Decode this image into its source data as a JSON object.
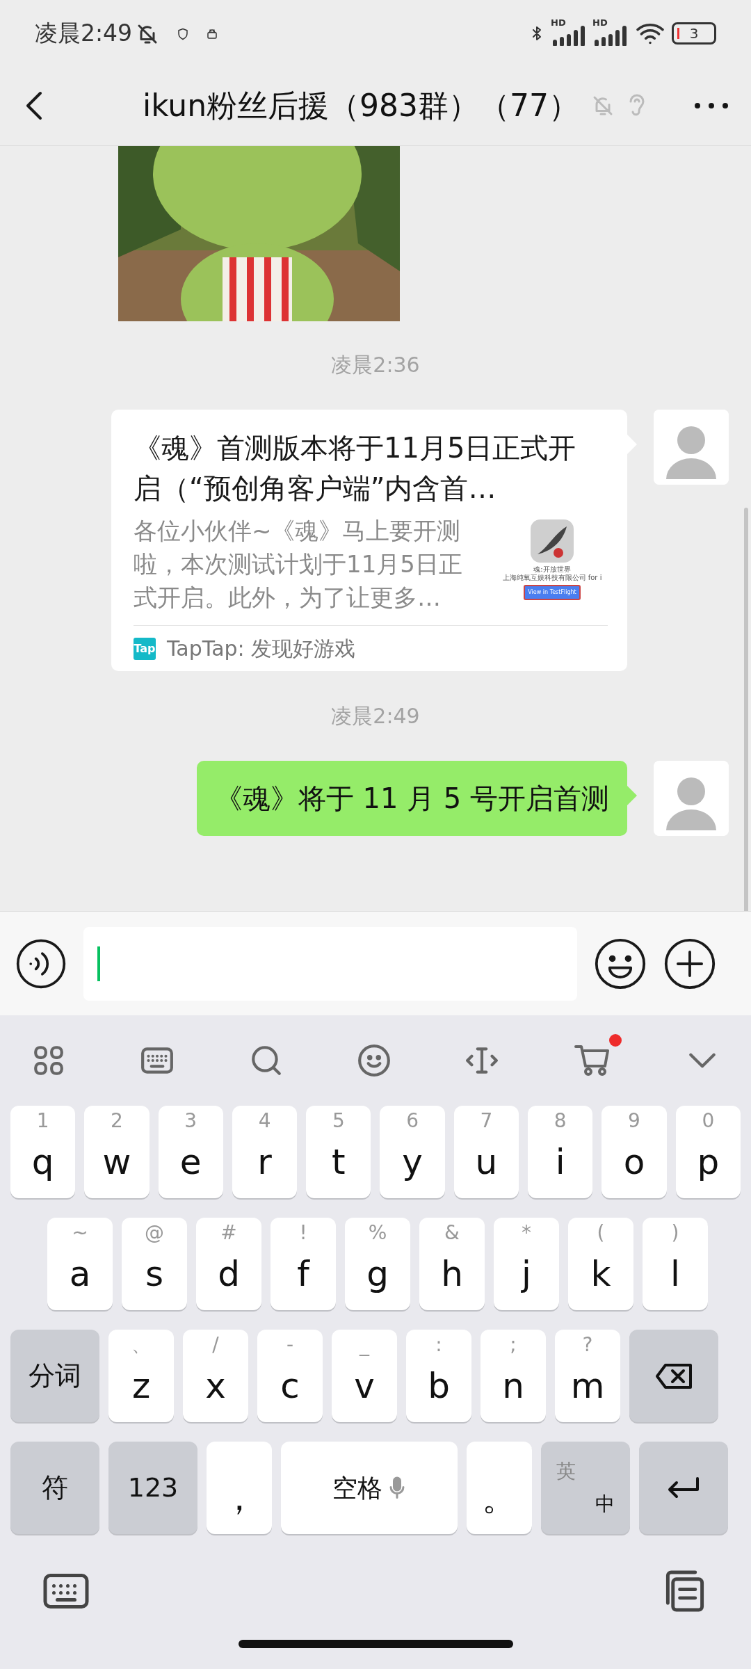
{
  "status_bar": {
    "time": "凌晨2:49",
    "signals": [
      {
        "label": "HD"
      },
      {
        "label": "HD"
      }
    ],
    "battery": "3"
  },
  "header": {
    "title": "ikun粉丝后援（983群）（77）"
  },
  "messages": [
    {
      "kind": "picture",
      "outgoing": false
    },
    {
      "kind": "time",
      "text": "凌晨2:36"
    },
    {
      "kind": "link_card",
      "outgoing": true,
      "title": "《魂》首测版本将于11月5日正式开启（“预创角客户端”内含首…",
      "description": "各位小伙伴~《魂》马上要开测啦，本次测试计划于11月5日正式开启。此外，为了让更多…",
      "thumbnail": {
        "app_name": "魂:开放世界",
        "developer": "上海纯氧互娱科技有限公司 for i",
        "button": "View in TestFlight"
      },
      "source_logo": "Tap",
      "source": "TapTap: 发现好游戏"
    },
    {
      "kind": "time",
      "text": "凌晨2:49"
    },
    {
      "kind": "text",
      "outgoing": true,
      "text": "《魂》将于 11 月 5 号开启首测"
    }
  ],
  "keyboard": {
    "rows": [
      {
        "keys": [
          {
            "kind": "char",
            "label": "q",
            "hint": "1"
          },
          {
            "kind": "char",
            "label": "w",
            "hint": "2"
          },
          {
            "kind": "char",
            "label": "e",
            "hint": "3"
          },
          {
            "kind": "char",
            "label": "r",
            "hint": "4"
          },
          {
            "kind": "char",
            "label": "t",
            "hint": "5"
          },
          {
            "kind": "char",
            "label": "y",
            "hint": "6"
          },
          {
            "kind": "char",
            "label": "u",
            "hint": "7"
          },
          {
            "kind": "char",
            "label": "i",
            "hint": "8"
          },
          {
            "kind": "char",
            "label": "o",
            "hint": "9"
          },
          {
            "kind": "char",
            "label": "p",
            "hint": "0"
          }
        ]
      },
      {
        "keys": [
          {
            "kind": "char",
            "label": "a",
            "hint": "~"
          },
          {
            "kind": "char",
            "label": "s",
            "hint": "@"
          },
          {
            "kind": "char",
            "label": "d",
            "hint": "#"
          },
          {
            "kind": "char",
            "label": "f",
            "hint": "!"
          },
          {
            "kind": "char",
            "label": "g",
            "hint": "%"
          },
          {
            "kind": "char",
            "label": "h",
            "hint": "&"
          },
          {
            "kind": "char",
            "label": "j",
            "hint": "*"
          },
          {
            "kind": "char",
            "label": "k",
            "hint": "("
          },
          {
            "kind": "char",
            "label": "l",
            "hint": ")"
          }
        ]
      },
      {
        "keys": [
          {
            "kind": "func",
            "label": "分词"
          },
          {
            "kind": "char",
            "label": "z",
            "hint": "、"
          },
          {
            "kind": "char",
            "label": "x",
            "hint": "/"
          },
          {
            "kind": "char",
            "label": "c",
            "hint": "-"
          },
          {
            "kind": "char",
            "label": "v",
            "hint": "_"
          },
          {
            "kind": "char",
            "label": "b",
            "hint": ":"
          },
          {
            "kind": "char",
            "label": "n",
            "hint": ";"
          },
          {
            "kind": "char",
            "label": "m",
            "hint": "?"
          },
          {
            "kind": "backspace"
          }
        ]
      },
      {
        "keys": [
          {
            "kind": "func",
            "label": "符"
          },
          {
            "kind": "func",
            "label": "123"
          },
          {
            "kind": "char",
            "label": "，"
          },
          {
            "kind": "space",
            "label": "空格"
          },
          {
            "kind": "char",
            "label": "。"
          },
          {
            "kind": "lang",
            "label": "英",
            "sub": "中"
          },
          {
            "kind": "enter"
          }
        ]
      }
    ]
  }
}
